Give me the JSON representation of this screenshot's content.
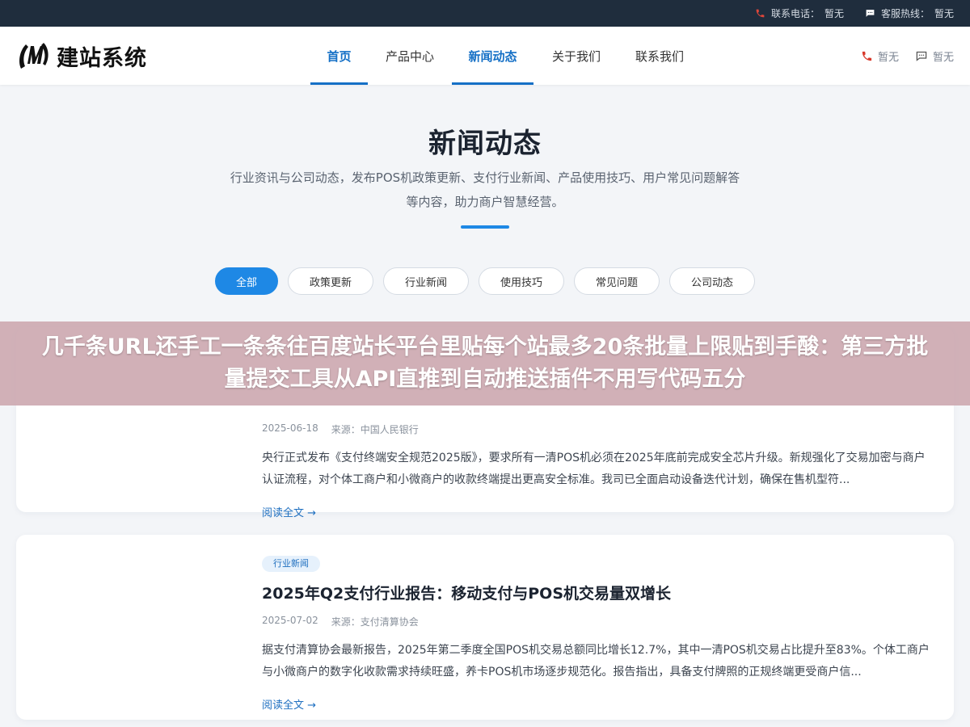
{
  "topbar": {
    "phone_label": "联系电话：",
    "phone_value": "暂无",
    "hotline_label": "客服热线：",
    "hotline_value": "暂无"
  },
  "header": {
    "logo_text": "建站系统",
    "nav": [
      {
        "label": "首页",
        "active": true
      },
      {
        "label": "产品中心",
        "active": false
      },
      {
        "label": "新闻动态",
        "active": true
      },
      {
        "label": "关于我们",
        "active": false
      },
      {
        "label": "联系我们",
        "active": false
      }
    ],
    "right_phone": "暂无",
    "right_chat": "暂无"
  },
  "hero": {
    "title": "新闻动态",
    "desc_line1": "行业资讯与公司动态，发布POS机政策更新、支付行业新闻、产品使用技巧、用户常见问题解答",
    "desc_line2": "等内容，助力商户智慧经营。"
  },
  "filters": [
    "全部",
    "政策更新",
    "行业新闻",
    "使用技巧",
    "常见问题",
    "公司动态"
  ],
  "articles": [
    {
      "date": "2025-06-18",
      "source": "来源：中国人民银行",
      "excerpt": "央行正式发布《支付终端安全规范2025版》，要求所有一清POS机必须在2025年底前完成安全芯片升级。新规强化了交易加密与商户认证流程，对个体工商户和小微商户的收款终端提出更高安全标准。我司已全面启动设备迭代计划，确保在售机型符...",
      "read_more": "阅读全文 →"
    },
    {
      "tag": "行业新闻",
      "title": "2025年Q2支付行业报告：移动支付与POS机交易量双增长",
      "date": "2025-07-02",
      "source": "来源：支付清算协会",
      "excerpt": "据支付清算协会最新报告，2025年第二季度全国POS机交易总额同比增长12.7%，其中一清POS机交易占比提升至83%。个体工商户与小微商户的数字化收款需求持续旺盛，养卡POS机市场逐步规范化。报告指出，具备支付牌照的正规终端更受商户信...",
      "read_more": "阅读全文 →"
    }
  ],
  "banner": {
    "text": "几千条URL还手工一条条往百度站长平台里贴每个站最多20条批量上限贴到手酸：第三方批量提交工具从API直推到自动推送插件不用写代码五分"
  },
  "colors": {
    "primary": "#1e88e5",
    "nav_active": "#1570c6",
    "topbar_bg": "#1f2d3d",
    "banner_bg": "#cdaab2"
  }
}
